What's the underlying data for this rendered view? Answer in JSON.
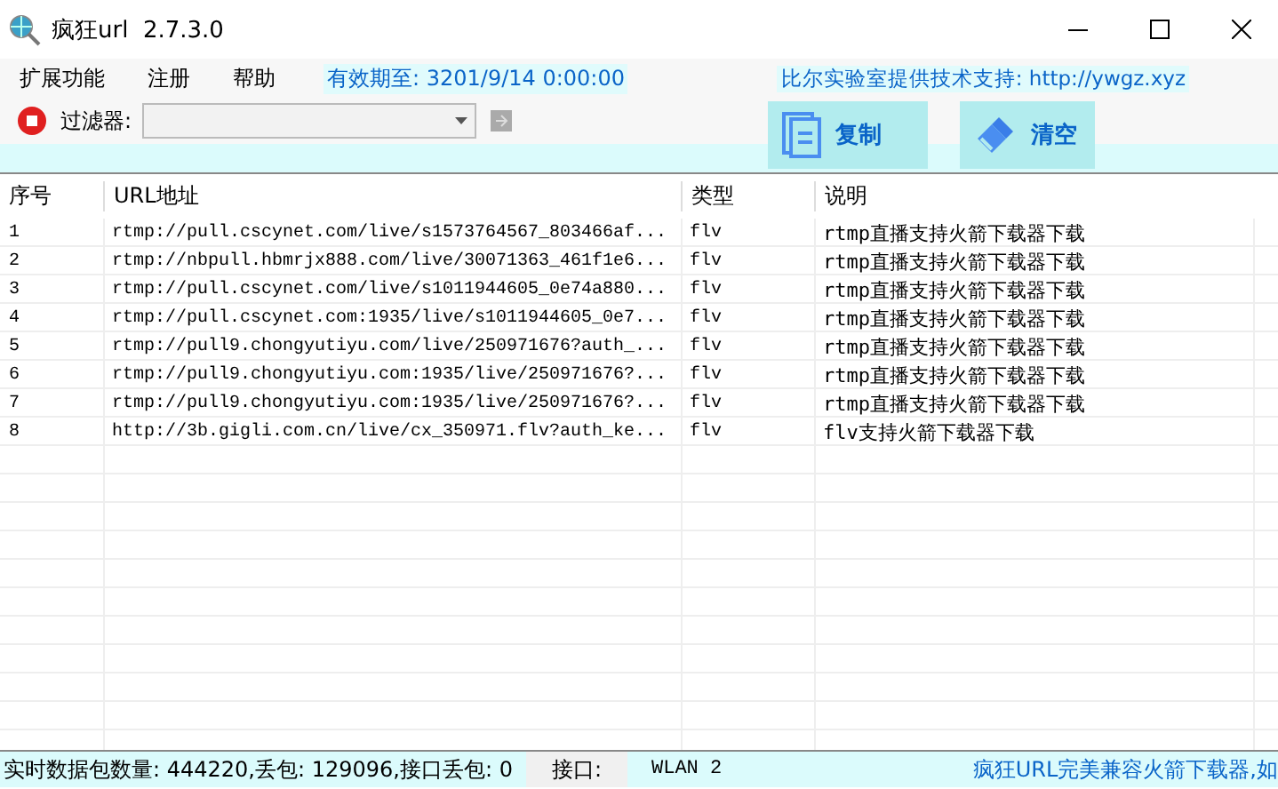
{
  "window": {
    "title": "疯狂url  2.7.3.0"
  },
  "menu": [
    {
      "label": "扩展功能"
    },
    {
      "label": "注册"
    },
    {
      "label": "帮助"
    }
  ],
  "expiry": "有效期至: 3201/9/14 0:00:00",
  "support": "比尔实验室提供技术支持: http://ywgz.xyz",
  "toolbar": {
    "filter_label": "过滤器:",
    "buttons": [
      {
        "label": "复制",
        "kind": "copy"
      },
      {
        "label": "清空",
        "kind": "clear"
      }
    ]
  },
  "table": {
    "columns": [
      "序号",
      "URL地址",
      "类型",
      "说明"
    ],
    "rows": [
      [
        "1",
        "rtmp://pull.cscynet.com/live/s1573764567_803466af...",
        "flv",
        "rtmp直播支持火箭下载器下载"
      ],
      [
        "2",
        "rtmp://nbpull.hbmrjx888.com/live/30071363_461f1e6...",
        "flv",
        "rtmp直播支持火箭下载器下载"
      ],
      [
        "3",
        "rtmp://pull.cscynet.com/live/s1011944605_0e74a880...",
        "flv",
        "rtmp直播支持火箭下载器下载"
      ],
      [
        "4",
        "rtmp://pull.cscynet.com:1935/live/s1011944605_0e7...",
        "flv",
        "rtmp直播支持火箭下载器下载"
      ],
      [
        "5",
        "rtmp://pull9.chongyutiyu.com/live/250971676?auth_...",
        "flv",
        "rtmp直播支持火箭下载器下载"
      ],
      [
        "6",
        "rtmp://pull9.chongyutiyu.com:1935/live/250971676?...",
        "flv",
        "rtmp直播支持火箭下载器下载"
      ],
      [
        "7",
        "rtmp://pull9.chongyutiyu.com:1935/live/250971676?...",
        "flv",
        "rtmp直播支持火箭下载器下载"
      ],
      [
        "8",
        "http://3b.gigli.com.cn/live/cx_350971.flv?auth_ke...",
        "flv",
        "flv支持火箭下载器下载"
      ]
    ]
  },
  "status_bar": {
    "packets": "实时数据包数量: 444220,丢包: 129096,接口丢包: 0",
    "interface_label": "接口:",
    "interface": "WLAN 2",
    "notice": "疯狂URL完美兼容火箭下载器,如"
  }
}
